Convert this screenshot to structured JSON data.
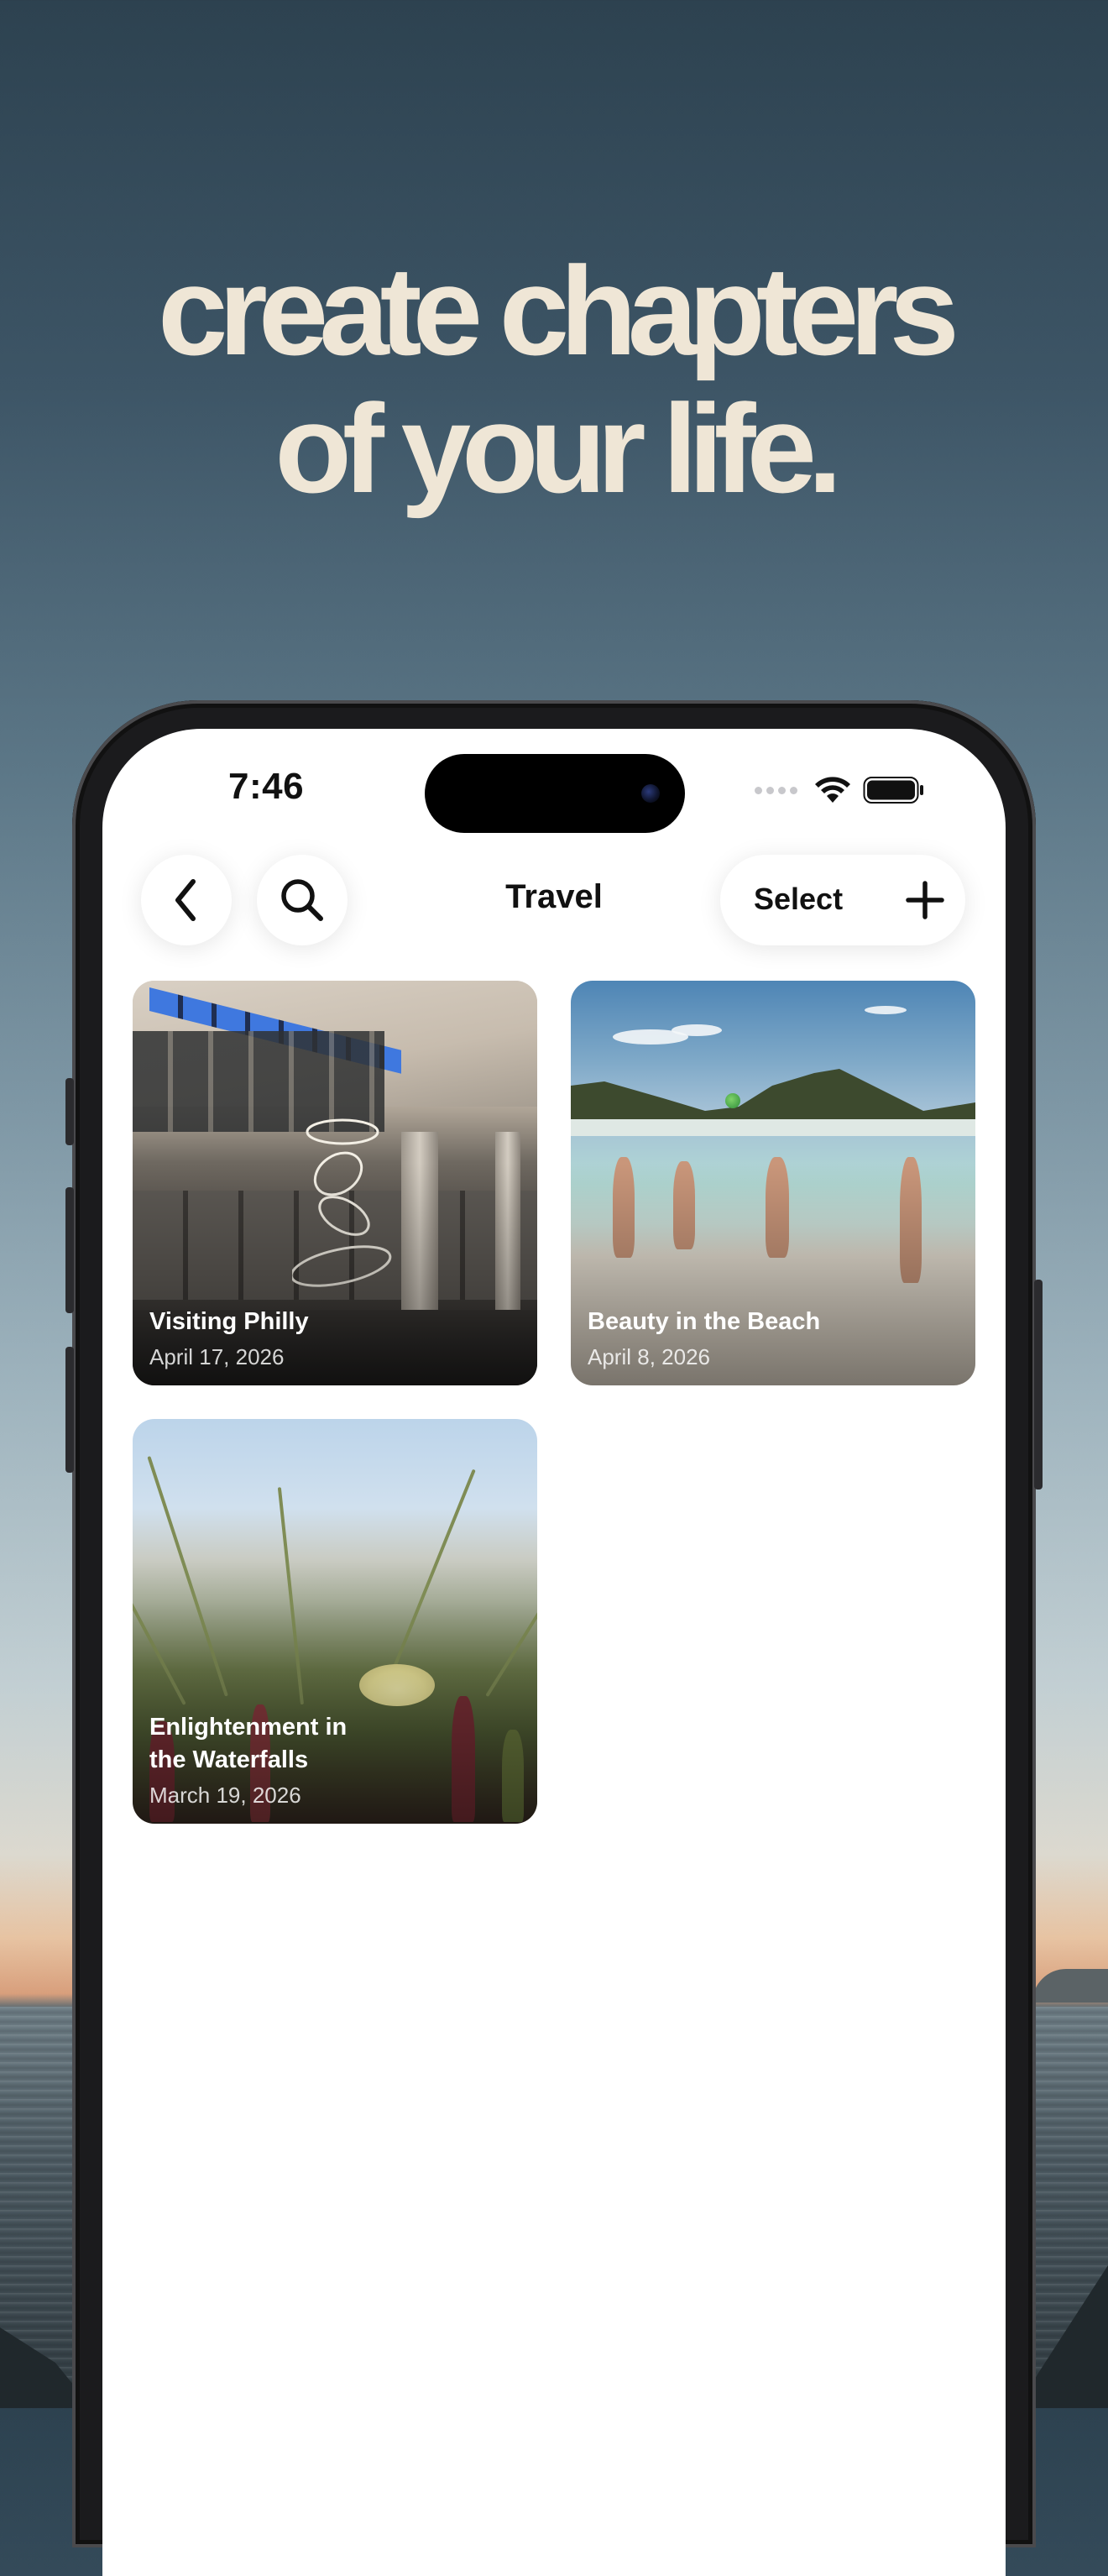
{
  "headline": {
    "line1": "create chapters",
    "line2": "of your life."
  },
  "status_bar": {
    "time": "7:46"
  },
  "nav": {
    "back_icon": "chevron-left-icon",
    "search_icon": "magnifying-glass-icon",
    "title": "Travel",
    "select_label": "Select",
    "add_icon": "plus-icon"
  },
  "chapters": [
    {
      "title": "Visiting Philly",
      "date": "April 17, 2026"
    },
    {
      "title": "Beauty in the Beach",
      "date": "April 8, 2026"
    },
    {
      "title": "Enlightenment in the Waterfalls",
      "date": "March 19, 2026"
    }
  ],
  "colors": {
    "headline": "#efe6d6",
    "sky_top": "#2d4250",
    "screen_bg": "#ffffff",
    "text_primary": "#111111"
  }
}
